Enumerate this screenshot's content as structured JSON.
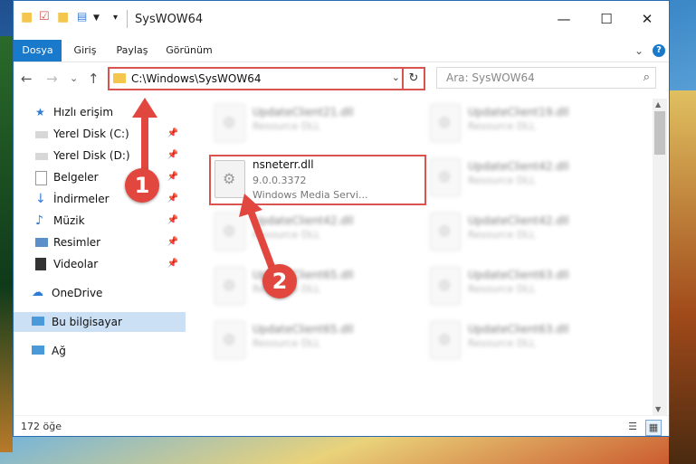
{
  "window": {
    "title": "SysWOW64",
    "minimize": "—",
    "maximize": "☐",
    "close": "✕"
  },
  "ribbon": {
    "tabs": [
      "Dosya",
      "Giriş",
      "Paylaş",
      "Görünüm"
    ],
    "help": "?",
    "collapse": "⌄"
  },
  "navigation": {
    "back": "←",
    "forward": "→",
    "recent": "⌄",
    "up": "↑",
    "address": "C:\\Windows\\SysWOW64",
    "refresh": "↻",
    "search_placeholder": "Ara: SysWOW64"
  },
  "sidebar": {
    "items": [
      {
        "label": "Hızlı erişim",
        "icon": "star-icon",
        "pinned": false
      },
      {
        "label": "Yerel Disk (C:)",
        "icon": "drive-icon",
        "pinned": true
      },
      {
        "label": "Yerel Disk (D:)",
        "icon": "drive-icon",
        "pinned": true
      },
      {
        "label": "Belgeler",
        "icon": "documents-icon",
        "pinned": true
      },
      {
        "label": "İndirmeler",
        "icon": "download-icon",
        "pinned": true
      },
      {
        "label": "Müzik",
        "icon": "music-icon",
        "pinned": true
      },
      {
        "label": "Resimler",
        "icon": "pictures-icon",
        "pinned": true
      },
      {
        "label": "Videolar",
        "icon": "video-icon",
        "pinned": true
      },
      {
        "label": "OneDrive",
        "icon": "cloud-icon",
        "pinned": false
      },
      {
        "label": "Bu bilgisayar",
        "icon": "computer-icon",
        "pinned": false,
        "selected": true
      },
      {
        "label": "Ağ",
        "icon": "network-icon",
        "pinned": false
      }
    ]
  },
  "files": {
    "highlighted": {
      "name": "nsneterr.dll",
      "version": "9.0.0.3372",
      "description": "Windows Media Servi..."
    },
    "left_column": [
      {
        "name": "UpdateClient21.dll",
        "type": "Resource DLL"
      },
      {
        "name": "UpdateClient42.dll",
        "type": "Resource DLL"
      },
      {
        "name": "UpdateClient65.dll",
        "type": "Resource DLL"
      },
      {
        "name": "UpdateClient65.dll",
        "type": "Resource DLL"
      }
    ],
    "right_column": [
      {
        "name": "UpdateClient19.dll",
        "type": "Resource DLL"
      },
      {
        "name": "UpdateClient42.dll",
        "type": "Resource DLL"
      },
      {
        "name": "UpdateClient42.dll",
        "type": "Resource DLL"
      },
      {
        "name": "UpdateClient63.dll",
        "type": "Resource DLL"
      },
      {
        "name": "UpdateClient63.dll",
        "type": "Resource DLL"
      }
    ]
  },
  "status": {
    "count": "172 öğe"
  },
  "callouts": [
    "1",
    "2"
  ],
  "colors": {
    "accent": "#1979ca",
    "highlight": "#d9534f",
    "selected": "#cce0f5"
  }
}
